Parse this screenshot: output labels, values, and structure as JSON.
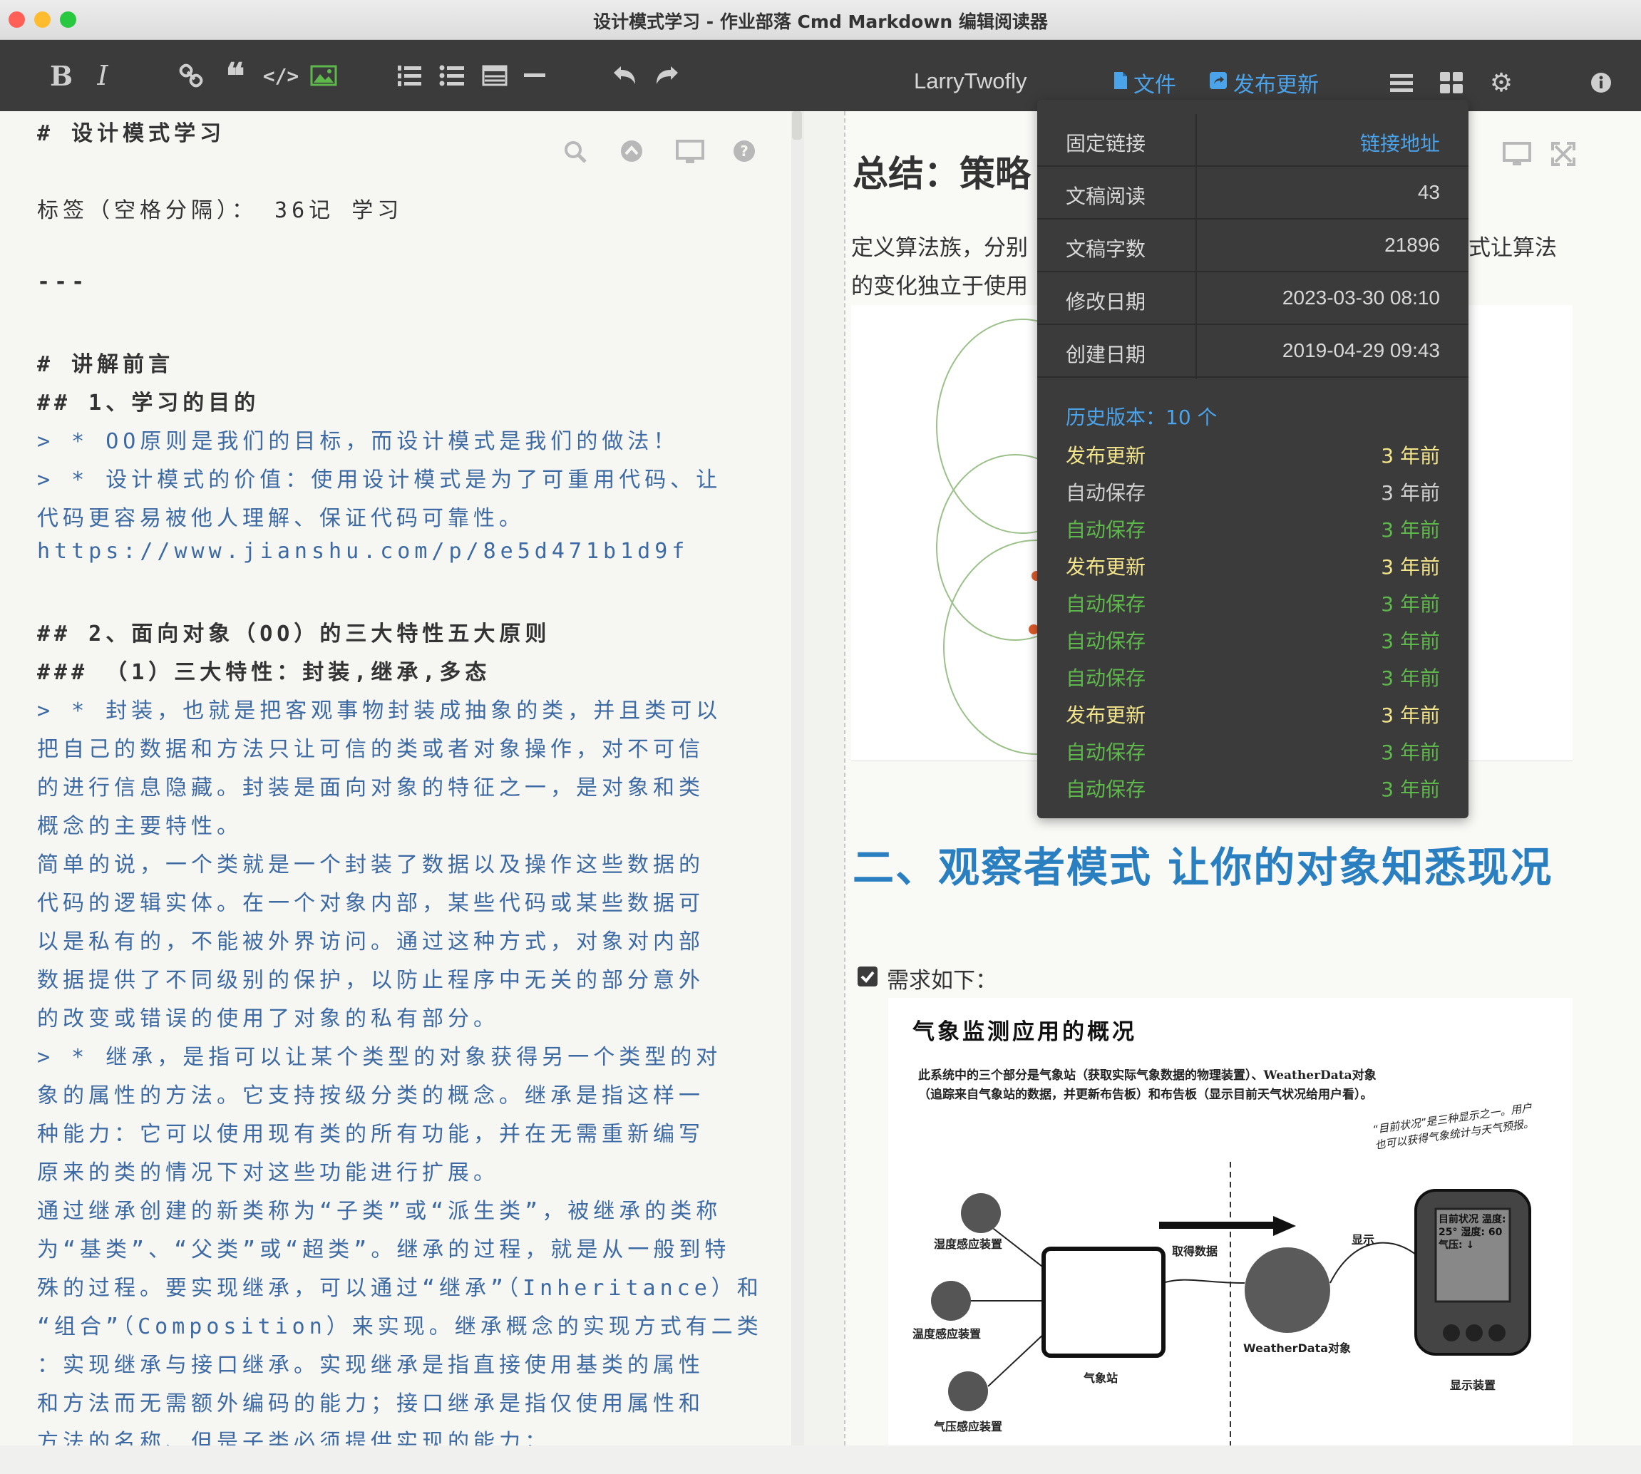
{
  "window": {
    "title": "设计模式学习 - 作业部落 Cmd Markdown 编辑阅读器"
  },
  "colors": {
    "accent": "#4ba3ea",
    "toolbar": "#3b3b3b",
    "heading_blue": "#2a7fc1",
    "history_yellow": "#f2e48a",
    "history_green": "#5fb84c"
  },
  "toolbar": {
    "icons": [
      "bold-icon",
      "italic-icon",
      "link-icon",
      "quote-icon",
      "code-icon",
      "image-icon",
      "ordered-list-icon",
      "unordered-list-icon",
      "table-icon",
      "hr-icon",
      "undo-icon",
      "redo-icon"
    ],
    "user": "LarryTwofly",
    "file_label": "文件",
    "publish_label": "发布更新"
  },
  "editor": {
    "lines": [
      {
        "text": "# 设计模式学习",
        "style": "h"
      },
      {
        "text": "标签（空格分隔）： 36记 学习",
        "style": "plain"
      },
      {
        "text": "---",
        "style": "h"
      },
      {
        "text": "# 讲解前言",
        "style": "h"
      },
      {
        "text": "## 1、学习的目的",
        "style": "h"
      },
      {
        "text": "> * OO原则是我们的目标，而设计模式是我们的做法！",
        "style": "q"
      },
      {
        "text": "> * 设计模式的价值：使用设计模式是为了可重用代码、让",
        "style": "q"
      },
      {
        "text": "代码更容易被他人理解、保证代码可靠性。",
        "style": "q"
      },
      {
        "text": "https://www.jianshu.com/p/8e5d471b1d9f",
        "style": "q"
      },
      {
        "text": "## 2、面向对象（OO）的三大特性五大原则",
        "style": "h"
      },
      {
        "text": "### （1）三大特性：封装,继承,多态",
        "style": "h"
      },
      {
        "text": "> * 封装，也就是把客观事物封装成抽象的类，并且类可以",
        "style": "q"
      },
      {
        "text": "把自己的数据和方法只让可信的类或者对象操作，对不可信",
        "style": "q"
      },
      {
        "text": "的进行信息隐藏。封装是面向对象的特征之一，是对象和类",
        "style": "q"
      },
      {
        "text": "概念的主要特性。",
        "style": "q"
      },
      {
        "text": "简单的说，一个类就是一个封装了数据以及操作这些数据的",
        "style": "q"
      },
      {
        "text": "代码的逻辑实体。在一个对象内部，某些代码或某些数据可",
        "style": "q"
      },
      {
        "text": "以是私有的，不能被外界访问。通过这种方式，对象对内部",
        "style": "q"
      },
      {
        "text": "数据提供了不同级别的保护，以防止程序中无关的部分意外",
        "style": "q"
      },
      {
        "text": "的改变或错误的使用了对象的私有部分。",
        "style": "q"
      },
      {
        "text": "> * 继承，是指可以让某个类型的对象获得另一个类型的对",
        "style": "q"
      },
      {
        "text": "象的属性的方法。它支持按级分类的概念。继承是指这样一",
        "style": "q"
      },
      {
        "text": "种能力：它可以使用现有类的所有功能，并在无需重新编写",
        "style": "q"
      },
      {
        "text": "原来的类的情况下对这些功能进行扩展。",
        "style": "q"
      },
      {
        "text": "通过继承创建的新类称为“子类”或“派生类”，被继承的类称",
        "style": "q"
      },
      {
        "text": "为“基类”、“父类”或“超类”。继承的过程，就是从一般到特",
        "style": "q"
      },
      {
        "text": "殊的过程。要实现继承，可以通过“继承”（Inheritance）和",
        "style": "q"
      },
      {
        "text": "“组合”（Composition）来实现。继承概念的实现方式有二类",
        "style": "q"
      },
      {
        "text": "：实现继承与接口继承。实现继承是指直接使用基类的属性",
        "style": "q"
      },
      {
        "text": "和方法而无需额外编码的能力；接口继承是指仅使用属性和",
        "style": "q"
      },
      {
        "text": "方法的名称、但是子类必须提供实现的能力；",
        "style": "q"
      }
    ]
  },
  "preview": {
    "h1": "总结：策略",
    "p1_left": "定义算法族，分别",
    "p1_right": "式让算法",
    "p2_left": "的变化独立于使用",
    "h2": "二、观察者模式 让你的对象知悉现况",
    "task": "需求如下：",
    "figure": {
      "title": "气象监测应用的概况",
      "desc": "此系统中的三个部分是气象站（获取实际气象数据的物理装置）、WeatherData对象（追踪来自气象站的数据，并更新布告板）和布告板（显示目前天气状况给用户看）。",
      "note": "“目前状况”是三种显示之一。用户也可以获得气象统计与天气预报。",
      "labels": {
        "humidity": "湿度感应装置",
        "temperature": "温度感应装置",
        "pressure": "气压感应装置",
        "station": "气象站",
        "fetch": "取得数据",
        "weatherdata": "WeatherData对象",
        "display": "显示",
        "device": "显示装置",
        "screen": "目前状况 温度: 25° 湿度: 60 气压: ↓"
      }
    }
  },
  "popup": {
    "rows": [
      {
        "k": "固定链接",
        "v": "链接地址",
        "link": true
      },
      {
        "k": "文稿阅读",
        "v": "43"
      },
      {
        "k": "文稿字数",
        "v": "21896"
      },
      {
        "k": "修改日期",
        "v": "2023-03-30 08:10"
      },
      {
        "k": "创建日期",
        "v": "2019-04-29 09:43"
      }
    ],
    "history_title": "历史版本：10 个",
    "history": [
      {
        "action": "发布更新",
        "time": "3 年前",
        "color": "yellow"
      },
      {
        "action": "自动保存",
        "time": "3 年前",
        "color": "gray"
      },
      {
        "action": "自动保存",
        "time": "3 年前",
        "color": "green"
      },
      {
        "action": "发布更新",
        "time": "3 年前",
        "color": "yellow"
      },
      {
        "action": "自动保存",
        "time": "3 年前",
        "color": "green"
      },
      {
        "action": "自动保存",
        "time": "3 年前",
        "color": "green"
      },
      {
        "action": "自动保存",
        "time": "3 年前",
        "color": "green"
      },
      {
        "action": "发布更新",
        "time": "3 年前",
        "color": "yellow"
      },
      {
        "action": "自动保存",
        "time": "3 年前",
        "color": "green"
      },
      {
        "action": "自动保存",
        "time": "3 年前",
        "color": "green"
      }
    ]
  }
}
